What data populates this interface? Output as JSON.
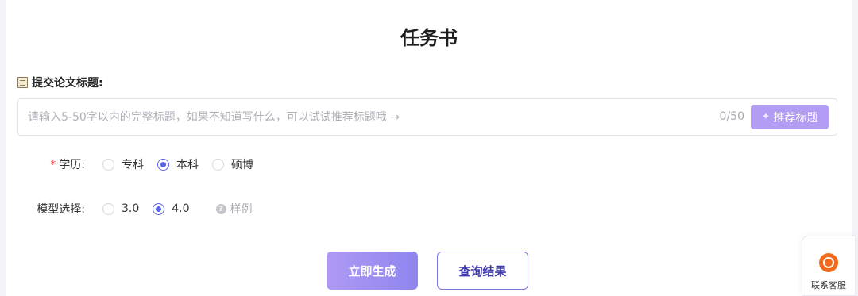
{
  "page": {
    "title": "任务书"
  },
  "title_section": {
    "label": "提交论文标题:",
    "placeholder": "请输入5-50字以内的完整标题，如果不知道写什么，可以试试推荐标题哦 →",
    "value": "",
    "counter": "0/50",
    "recommend_label": "推荐标题",
    "recommend_icon": "sparkle-icon"
  },
  "education": {
    "required_mark": "*",
    "label": "学历:",
    "options": [
      "专科",
      "本科",
      "硕博"
    ],
    "selected": "本科"
  },
  "model": {
    "label": "模型选择:",
    "options": [
      "3.0",
      "4.0"
    ],
    "selected": "4.0",
    "sample_label": "样例",
    "sample_icon": "help-icon"
  },
  "actions": {
    "generate_label": "立即生成",
    "query_label": "查询结果"
  },
  "service": {
    "label": "联系客服",
    "icon": "headset-icon"
  },
  "colors": {
    "accent": "#5b63e6",
    "recommend_bg": "#b29cf4",
    "service_icon": "#f36a1b",
    "required": "#f04b4b"
  }
}
